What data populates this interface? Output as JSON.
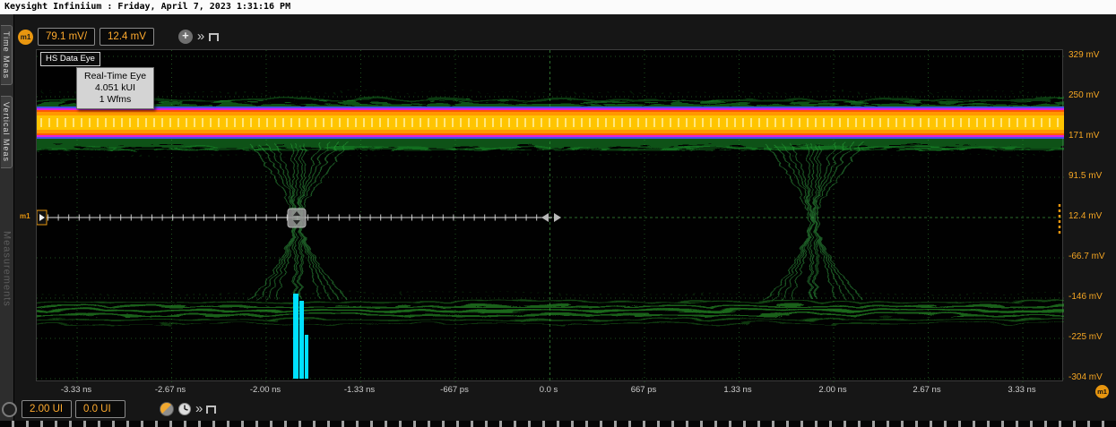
{
  "window": {
    "title": "Keysight Infiniium : Friday, April 7, 2023 1:31:16 PM"
  },
  "sidebar": {
    "tabs": [
      {
        "label": "Time Meas"
      },
      {
        "label": "Vertical Meas"
      }
    ],
    "panel_label": "Measurements"
  },
  "top_toolbar": {
    "marker_badge": "m1",
    "vertical_scale": "79.1 mV/",
    "vertical_offset": "12.4 mV"
  },
  "plot": {
    "title_tab": "HS Data Eye",
    "tooltip": {
      "title": "Real-Time Eye",
      "population": "4.051 kUI",
      "waveforms": "1 Wfms"
    },
    "marker_label": "m1"
  },
  "y_axis": {
    "labels": [
      "329 mV",
      "250 mV",
      "171 mV",
      "91.5 mV",
      "12.4 mV",
      "-66.7 mV",
      "-146 mV",
      "-225 mV",
      "-304 mV"
    ]
  },
  "x_axis": {
    "labels": [
      "-3.33 ns",
      "-2.67 ns",
      "-2.00 ns",
      "-1.33 ns",
      "-667 ps",
      "0.0 s",
      "667 ps",
      "1.33 ns",
      "2.00 ns",
      "2.67 ns",
      "3.33 ns"
    ]
  },
  "bottom_toolbar": {
    "horizontal_scale": "2.00 UI",
    "horizontal_position": "0.0 UI"
  },
  "corner_badge": "m1",
  "colors": {
    "accent_orange": "#e8960f",
    "field_text_orange": "#ffab2e",
    "axis_label_orange": "#f5a623",
    "trace_green": "#39b54a",
    "eye_core_orange": "#ff9800",
    "eye_fringe_magenta": "#e020e0",
    "histogram_cyan": "#00e0ff"
  }
}
